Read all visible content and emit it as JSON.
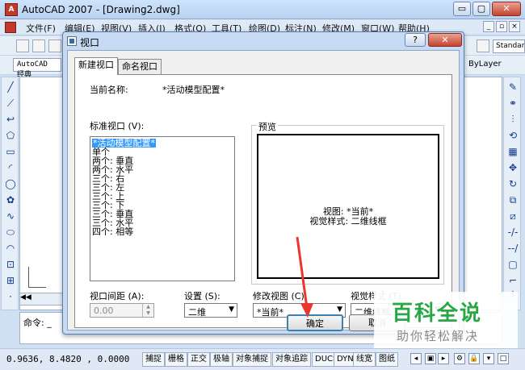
{
  "app": {
    "title": "AutoCAD 2007 - [Drawing2.dwg]",
    "minimize": "▭",
    "restore": "▢",
    "close": "✕",
    "menu": [
      "文件(F)",
      "编辑(E)",
      "视图(V)",
      "插入(I)",
      "格式(O)",
      "工具(T)",
      "绘图(D)",
      "标注(N)",
      "修改(M)",
      "窗口(W)",
      "帮助(H)"
    ],
    "text_style_combo": "AutoCAD 经典",
    "right_style_combo": "Standard",
    "layer_value": "ByLayer"
  },
  "command": {
    "prompt": "命令: _"
  },
  "status": {
    "coords": "0.9636,  8.4820 , 0.0000",
    "toggles": [
      "捕捉",
      "栅格",
      "正交",
      "极轴",
      "对象捕捉",
      "对象追踪",
      "DUCS",
      "DYN",
      "线宽",
      "图纸"
    ]
  },
  "dialog": {
    "title": "视口",
    "help_button": "?",
    "close_button": "✕",
    "tabs": [
      {
        "label": "新建视口",
        "active": true
      },
      {
        "label": "命名视口",
        "active": false
      }
    ],
    "current_name_label": "当前名称:",
    "current_name_value": "*活动模型配置*",
    "standard_viewports_label": "标准视口 (V):",
    "standard_viewports": [
      "*活动模型配置*",
      "单个",
      "两个:  垂直",
      "两个:  水平",
      "三个:  右",
      "三个:  左",
      "三个:  上",
      "三个:  下",
      "三个:  垂直",
      "三个:  水平",
      "四个:  相等"
    ],
    "selected_viewport_index": 0,
    "preview_label": "预览",
    "preview_line1": "视图: *当前*",
    "preview_line2": "视觉样式: 二维线框",
    "viewport_spacing_label": "视口间距 (A):",
    "viewport_spacing_value": "0.00",
    "setup_label": "设置 (S):",
    "setup_value": "二维",
    "change_view_label": "修改视图 (C):",
    "change_view_value": "*当前*",
    "visual_style_label": "视觉样式 (T):",
    "visual_style_value": "二维线框",
    "ok_button": "确定",
    "cancel_button": "取消"
  },
  "watermark": {
    "main": "百科全说",
    "sub": "助你轻松解决"
  },
  "colors": {
    "selection": "#3399ff",
    "annotation_arrow": "#e8372c",
    "watermark_green": "#28a745"
  }
}
